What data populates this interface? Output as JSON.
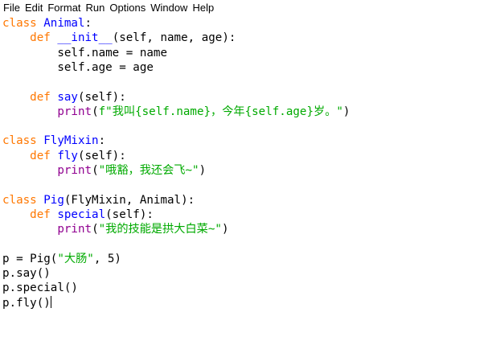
{
  "menu": [
    "File",
    "Edit",
    "Format",
    "Run",
    "Options",
    "Window",
    "Help"
  ],
  "code": [
    [
      {
        "t": "class",
        "c": "kw"
      },
      {
        "t": " "
      },
      {
        "t": "Animal",
        "c": "def"
      },
      {
        "t": ":"
      }
    ],
    [
      {
        "t": "    "
      },
      {
        "t": "def",
        "c": "kw"
      },
      {
        "t": " "
      },
      {
        "t": "__init__",
        "c": "def"
      },
      {
        "t": "(self, name, age):"
      }
    ],
    [
      {
        "t": "        self.name = name"
      }
    ],
    [
      {
        "t": "        self.age = age"
      }
    ],
    [
      {
        "t": ""
      }
    ],
    [
      {
        "t": "    "
      },
      {
        "t": "def",
        "c": "kw"
      },
      {
        "t": " "
      },
      {
        "t": "say",
        "c": "def"
      },
      {
        "t": "(self):"
      }
    ],
    [
      {
        "t": "        "
      },
      {
        "t": "print",
        "c": "bi"
      },
      {
        "t": "("
      },
      {
        "t": "f\"我叫{self.name}，今年{self.age}岁。\"",
        "c": "str"
      },
      {
        "t": ")"
      }
    ],
    [
      {
        "t": ""
      }
    ],
    [
      {
        "t": "class",
        "c": "kw"
      },
      {
        "t": " "
      },
      {
        "t": "FlyMixin",
        "c": "def"
      },
      {
        "t": ":"
      }
    ],
    [
      {
        "t": "    "
      },
      {
        "t": "def",
        "c": "kw"
      },
      {
        "t": " "
      },
      {
        "t": "fly",
        "c": "def"
      },
      {
        "t": "(self):"
      }
    ],
    [
      {
        "t": "        "
      },
      {
        "t": "print",
        "c": "bi"
      },
      {
        "t": "("
      },
      {
        "t": "\"哦豁，我还会飞~\"",
        "c": "str"
      },
      {
        "t": ")"
      }
    ],
    [
      {
        "t": ""
      }
    ],
    [
      {
        "t": "class",
        "c": "kw"
      },
      {
        "t": " "
      },
      {
        "t": "Pig",
        "c": "def"
      },
      {
        "t": "(FlyMixin, Animal):"
      }
    ],
    [
      {
        "t": "    "
      },
      {
        "t": "def",
        "c": "kw"
      },
      {
        "t": " "
      },
      {
        "t": "special",
        "c": "def"
      },
      {
        "t": "(self):"
      }
    ],
    [
      {
        "t": "        "
      },
      {
        "t": "print",
        "c": "bi"
      },
      {
        "t": "("
      },
      {
        "t": "\"我的技能是拱大白菜~\"",
        "c": "str"
      },
      {
        "t": ")"
      }
    ],
    [
      {
        "t": ""
      }
    ],
    [
      {
        "t": "p = Pig("
      },
      {
        "t": "\"大肠\"",
        "c": "str"
      },
      {
        "t": ", 5)"
      }
    ],
    [
      {
        "t": "p.say()"
      }
    ],
    [
      {
        "t": "p.special()"
      }
    ],
    [
      {
        "t": "p.fly()"
      }
    ]
  ],
  "cursor": {
    "line": 19
  }
}
